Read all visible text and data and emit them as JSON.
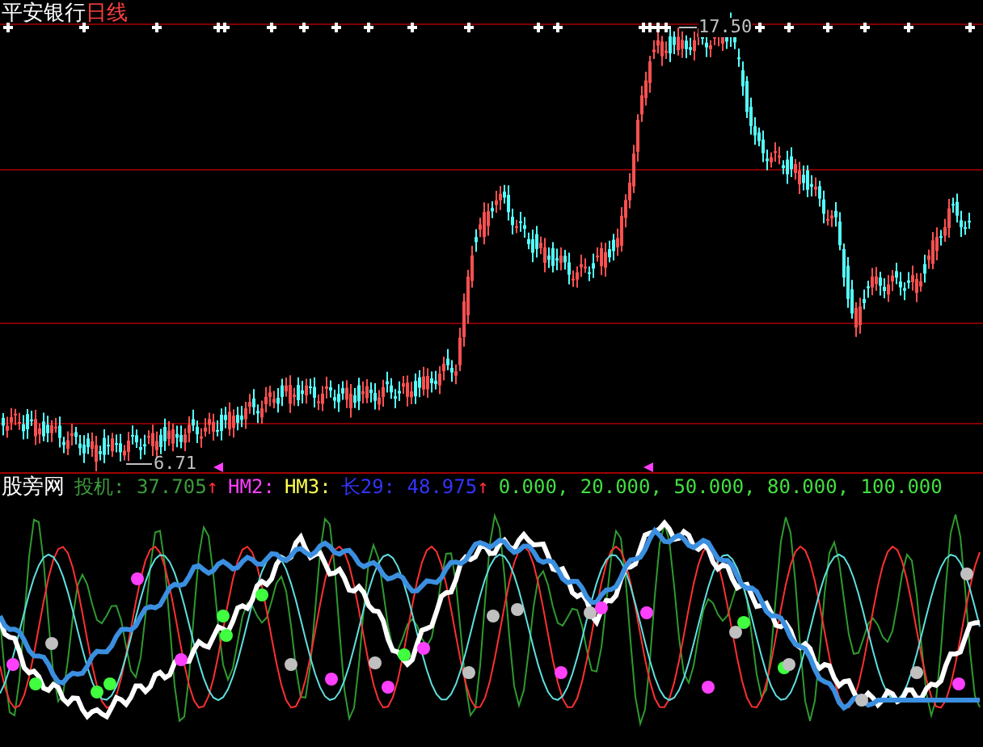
{
  "chart_title": {
    "stock": "平安银行",
    "period": "日线"
  },
  "price_labels": {
    "high": "17.50",
    "low": "6.71"
  },
  "indicator": {
    "name": "股旁网",
    "items": [
      {
        "label": "投机: 37.705",
        "arrow": "↑",
        "color": "#3c9c3c"
      },
      {
        "label": "HM2:",
        "color": "#ff40ff"
      },
      {
        "label": "HM3:",
        "color": "#ffff50"
      },
      {
        "label": "长29: 48.975",
        "arrow": "↑",
        "color": "#3434ff"
      },
      {
        "label": "0.000, 20.000, 50.000, 80.000, 100.000",
        "color": "#40e040"
      }
    ]
  }
}
